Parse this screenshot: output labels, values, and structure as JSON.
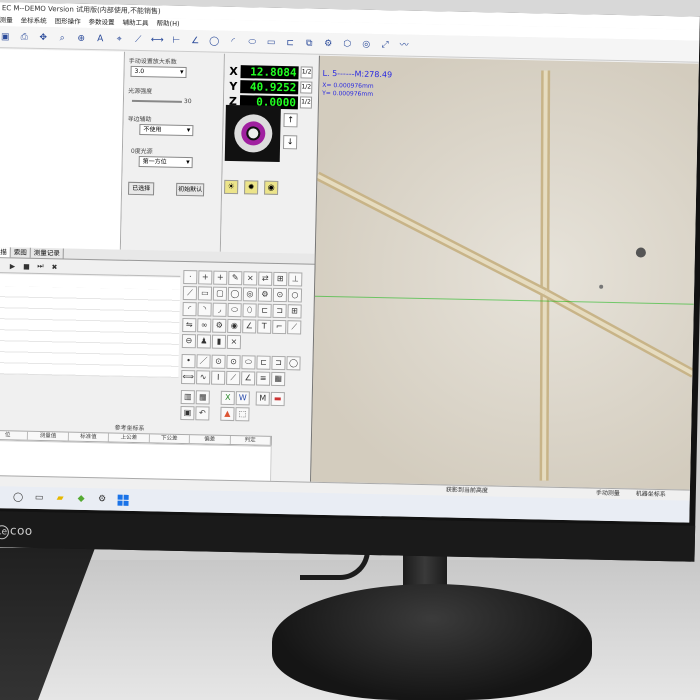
{
  "window": {
    "title": "EC M--DEMO Version   试用版(内部使用,不能销售)"
  },
  "menu": [
    "测量",
    "坐标系统",
    "图形操作",
    "参数设置",
    "辅助工具",
    "帮助(H)"
  ],
  "toolbar_icons": [
    "save-icon",
    "print-icon",
    "move-icon",
    "zoom-icon",
    "pan-icon",
    "text-icon"
  ],
  "left_panel": {
    "lens_label": "手动设置放大系数",
    "lens_value": "3.0",
    "light_label": "光源强度",
    "light_value": "30",
    "edge_label": "寻边辅助",
    "edge_value": "不使用",
    "light_pos_label": "0度光源",
    "light_pos_value": "第一方位",
    "calibrate_button": "已选择",
    "reset_button": "初始默认"
  },
  "dro": {
    "x_label": "X",
    "x_value": "12.8084",
    "x_unit": "1/2",
    "y_label": "Y",
    "y_value": "40.9252",
    "y_unit": "1/2",
    "z_label": "Z",
    "z_value": "0.0000",
    "z_unit": "1/2"
  },
  "tabs": [
    {
      "label": "扫描",
      "active": true
    },
    {
      "label": "索图",
      "active": false
    },
    {
      "label": "测量记录",
      "active": false
    }
  ],
  "coord_panel": {
    "title": "参考坐标系",
    "columns": [
      "位",
      "测量值",
      "标准值",
      "上公差",
      "下公差",
      "偏差",
      "判定"
    ]
  },
  "camera": {
    "overlay_main": "L. 5------M:278.49",
    "overlay_x": "X= 0.000976mm",
    "overlay_y": "Y= 0.000976mm"
  },
  "status_bar": {
    "center": "获影到当前高度",
    "right1": "手动测量",
    "right2": "机器坐标系"
  },
  "brand": {
    "logo_mark": "Le",
    "logo_text": "coo"
  },
  "colors": {
    "dro_bg": "#000000",
    "dro_text": "#22ff22",
    "overlay_text": "#2a2ae0",
    "scope_ring": "#a020a0"
  }
}
